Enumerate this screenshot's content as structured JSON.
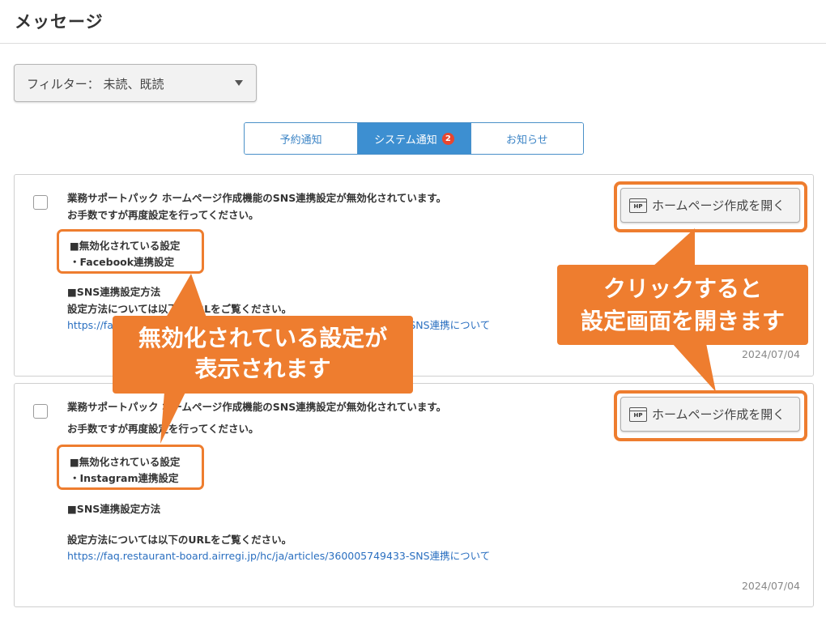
{
  "header": {
    "title": "メッセージ"
  },
  "filter": {
    "label": "フィルター： 未読、既読"
  },
  "tabs": [
    {
      "label": "予約通知"
    },
    {
      "label": "システム通知",
      "badge": "2"
    },
    {
      "label": "お知らせ"
    }
  ],
  "messages": [
    {
      "line1": "業務サポートパック ホームページ作成機能のSNS連携設定が無効化されています。",
      "line2": "お手数ですが再度設定を行ってください。",
      "disabled_heading": "■無効化されている設定",
      "disabled_item": "・Facebook連携設定",
      "method_heading": "■SNS連携設定方法",
      "method_text": "設定方法については以下のURLをご覧ください。",
      "url": "https://faq.restaurant-board.airregi.jp/hc/ja/articles/360005749433-SNS連携について",
      "date": "2024/07/04",
      "button_label": "ホームページ作成を開く"
    },
    {
      "line1": "業務サポートパック ホームページ作成機能のSNS連携設定が無効化されています。",
      "line2": "お手数ですが再度設定を行ってください。",
      "disabled_heading": "■無効化されている設定",
      "disabled_item": "・Instagram連携設定",
      "method_heading": "■SNS連携設定方法",
      "method_text": "設定方法については以下のURLをご覧ください。",
      "url": "https://faq.restaurant-board.airregi.jp/hc/ja/articles/360005749433-SNS連携について",
      "date": "2024/07/04",
      "button_label": "ホームページ作成を開く"
    }
  ],
  "callouts": {
    "left": [
      "無効化されている設定が",
      "表示されます"
    ],
    "right": [
      "クリックすると",
      "設定画面を開きます"
    ]
  },
  "icon_label": "HP",
  "colors": {
    "accent": "#ee7d2f",
    "tab_active": "#3d8fd1",
    "link": "#2a6fc0",
    "badge": "#e8462f"
  }
}
